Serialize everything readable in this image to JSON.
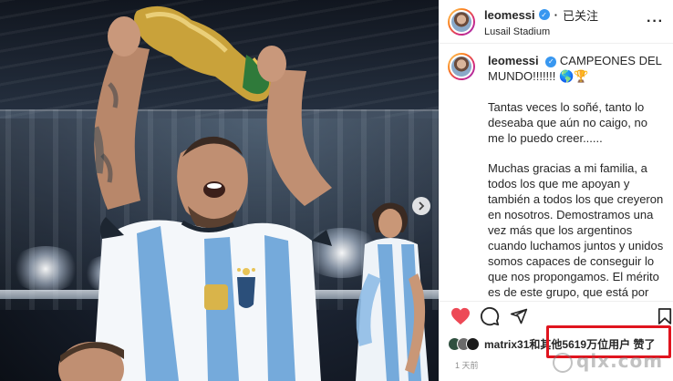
{
  "post": {
    "username": "leomessi",
    "follow_state": "已关注",
    "location": "Lusail Stadium",
    "caption": {
      "headline": "CAMPEONES DEL MUNDO!!!!!!!",
      "headline_emojis": "🌎🏆",
      "paragraph_1": "Tantas veces lo soñé, tanto lo deseaba que aún no caigo, no me lo puedo creer......",
      "paragraph_2": "Muchas gracias a mi familia, a todos los que me apoyan y también a todos los que creyeron en nosotros. Demostramos una vez más que los argentinos cuando luchamos juntos y unidos somos capaces de conseguir lo que nos propongamos. El mérito es de este grupo, que está por encima de las individualidades, es la fuerza de todos peleando por"
    },
    "likes": {
      "first_user": "matrix31",
      "connector": "和",
      "others_text": "其他5619万位用户",
      "suffix": "赞了"
    },
    "time_ago": "1 天前"
  },
  "watermark": "qix.com",
  "icons": {
    "header_more": "more-icon",
    "verified": "verified-badge-icon",
    "like": "heart-icon",
    "comment": "comment-icon",
    "share": "share-icon",
    "save": "bookmark-icon",
    "next": "chevron-right-icon"
  },
  "colors": {
    "like_red": "#ed4956",
    "verified_blue": "#3897f0",
    "highlight_red": "#e0141e",
    "argentina_sky": "#75aadb"
  }
}
